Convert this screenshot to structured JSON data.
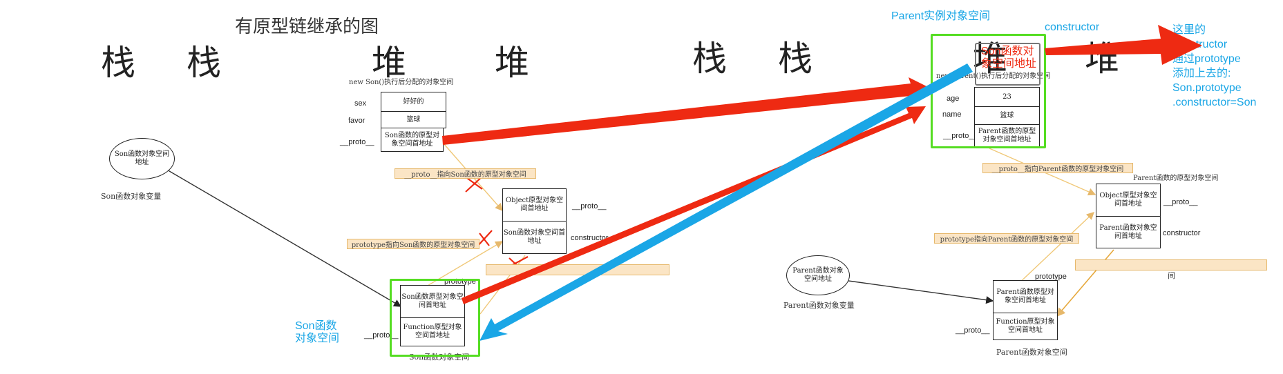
{
  "title": "有原型链继承的图",
  "headers": {
    "stack": "栈",
    "heap": "堆"
  },
  "left": {
    "new_son_caption": "new Son()执行后分配的对象空间",
    "fields": [
      "sex",
      "favor",
      "__proto__"
    ],
    "values": [
      "好好的",
      "篮球",
      "Son函数的原型对象空间首地址"
    ],
    "son_var_ellipse": "Son函数对象空间地址",
    "son_var_label": "Son函数对象变量",
    "band_proto": "__proto__指向Son函数的原型对象空间",
    "band_prototype": "prototype指向Son函数的原型对象空间",
    "son_proto_cells": [
      "Object原型对象空间首地址",
      "Son函数对象空间首地址"
    ],
    "son_proto_side": [
      "__proto__",
      "constructor"
    ],
    "prototype_label": "prototype",
    "son_obj_cells": [
      "Son函数原型对象空间首地址",
      "Function原型对象空间首地址"
    ],
    "son_obj_proto": "__proto__",
    "son_obj_caption": "Son函数对象空间",
    "son_obj_blue": "Son函数对象空间"
  },
  "right": {
    "parent_instance_blue": "Parent实例对象空间",
    "constructor_blue": "constructor",
    "new_parent_caption": "new Parent()执行后分配的对象空间",
    "red_note": "Son函数对象空间地址",
    "fields": [
      "age",
      "name",
      "__proto__"
    ],
    "values": [
      "23",
      "篮球",
      "Parent函数的原型对象空间首地址"
    ],
    "band_proto": "__proto__指向Parent函数的原型对象空间",
    "parent_proto_caption": "Parent函数的原型对象空间",
    "parent_proto_cells": [
      "Object原型对象空间首地址",
      "Parent函数对象空间首地址"
    ],
    "parent_proto_side": [
      "__proto__",
      "constructor"
    ],
    "band_prototype": "prototype指向Parent函数的原型对象空间",
    "band_right_tail": "间",
    "parent_var_ellipse": "Parent函数对象空间地址",
    "parent_var_label": "Parent函数对象变量",
    "prototype_label": "prototype",
    "parent_obj_cells": [
      "Parent函数原型对象空间首地址",
      "Function原型对象空间首地址"
    ],
    "parent_obj_proto": "__proto__",
    "parent_obj_caption": "Parent函数对象空间",
    "note_blue": [
      "这里的",
      "constructor",
      "通过prototype",
      "添加上去的:",
      "Son.prototype",
      ".constructor=Son"
    ]
  },
  "colors": {
    "red": "#ee2a12",
    "blue": "#1aa6e6",
    "green": "#55dd22",
    "band": "#fbe5c5",
    "band_border": "#e6b86b"
  }
}
